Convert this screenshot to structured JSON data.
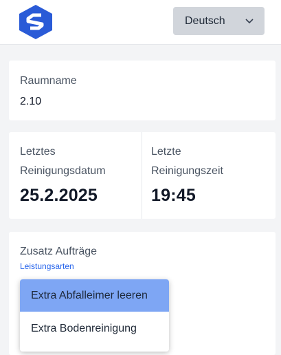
{
  "header": {
    "language_label": "Deutsch"
  },
  "room": {
    "label": "Raumname",
    "value": "2.10"
  },
  "last_cleaning": {
    "date_label_line1": "Letztes",
    "date_label_line2": "Reinigungsdatum",
    "date_value": "25.2.2025",
    "time_label_line1": "Letzte",
    "time_label_line2": "Reinigungszeit",
    "time_value": "19:45"
  },
  "extra": {
    "title": "Zusatz Aufträge",
    "link": "Leistungsarten",
    "options": [
      {
        "label": "Extra Abfalleimer leeren",
        "selected": true
      },
      {
        "label": "Extra Bodenreinigung",
        "selected": false
      }
    ]
  },
  "colors": {
    "accent": "#2563eb",
    "selected_option": "#7ea6f4",
    "language_button": "#d1d5db"
  }
}
